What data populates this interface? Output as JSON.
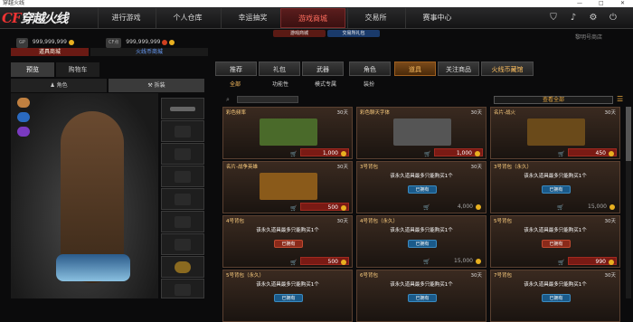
{
  "window": {
    "title": "穿越火线",
    "controls": [
      "—",
      "□",
      "✕"
    ]
  },
  "nav": {
    "logo": "穿越火线",
    "tabs": [
      "进行游戏",
      "个人仓库",
      "幸运抽奖",
      "游戏商城",
      "交易所",
      "赛事中心"
    ],
    "active_tab": "游戏商城"
  },
  "header_icons": [
    "shield-icon",
    "bell-icon",
    "gear-icon",
    "power-icon"
  ],
  "sub_tabs": [
    "游戏商城",
    "交易所礼包"
  ],
  "vip_label": "黎明号商店",
  "currency": {
    "gp_label": "GP",
    "gp_value": "999,999,999",
    "cf_label": "CF点",
    "cf_value": "999,999,999"
  },
  "shop_tabs": [
    "道具商城",
    "火线币商城"
  ],
  "left_tabs": [
    "预览",
    "购物车"
  ],
  "char_bar": {
    "role": "角色",
    "remove": "拆装"
  },
  "categories": [
    "推荐",
    "礼包",
    "武器",
    "角色",
    "道具",
    "关注商品",
    "火线币藏馆"
  ],
  "active_category": "道具",
  "filters": [
    "全部",
    "功能性",
    "模式专属",
    "装扮"
  ],
  "active_filter": "全部",
  "sort": {
    "label": "查看全部"
  },
  "cards": [
    {
      "name": "彩色频率",
      "days": "30天",
      "price": "1,000",
      "type": "item",
      "art": "#4a6a2a"
    },
    {
      "name": "彩色聊天字体",
      "days": "30天",
      "price": "1,000",
      "type": "item",
      "art": "#555"
    },
    {
      "name": "名片-战火",
      "days": "30天",
      "price": "450",
      "type": "item",
      "art": "#6a4a1a"
    },
    {
      "name": "名片-战争英雄",
      "days": "30天",
      "price": "500",
      "type": "item",
      "art": "#8a5a1a"
    },
    {
      "name": "3号背包",
      "days": "30天",
      "price": "4,000",
      "type": "owned",
      "notice": "该永久道具最多只能购买1个",
      "owned": "已拥有"
    },
    {
      "name": "3号背包（永久）",
      "days": "",
      "price": "15,000",
      "type": "owned",
      "notice": "该永久道具最多只能购买1个",
      "owned": "已拥有"
    },
    {
      "name": "4号背包",
      "days": "30天",
      "price": "500",
      "type": "owned_red",
      "notice": "该永久道具最多只能购买1个",
      "owned": "已拥有"
    },
    {
      "name": "4号背包（永久）",
      "days": "",
      "price": "15,000",
      "type": "owned",
      "notice": "该永久道具最多只能购买1个",
      "owned": "已拥有"
    },
    {
      "name": "5号背包",
      "days": "30天",
      "price": "990",
      "type": "owned_red",
      "notice": "该永久道具最多只能购买1个",
      "owned": "已拥有"
    },
    {
      "name": "5号背包（永久）",
      "days": "",
      "price": "",
      "type": "partial",
      "notice": "该永久道具最多只能购买1个",
      "owned": "已拥有"
    },
    {
      "name": "6号背包",
      "days": "30天",
      "price": "",
      "type": "partial",
      "notice": "该永久道具最多只能购买1个",
      "owned": "已拥有"
    },
    {
      "name": "7号背包",
      "days": "30天",
      "price": "",
      "type": "partial",
      "notice": "该永久道具最多只能购买1个",
      "owned": "已拥有"
    }
  ]
}
